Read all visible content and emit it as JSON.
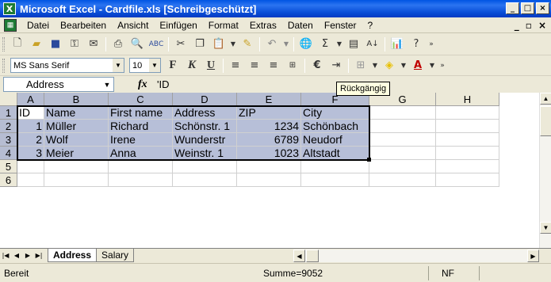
{
  "window": {
    "title": "Microsoft Excel - Cardfile.xls  [Schreibgeschützt]",
    "controls": [
      "_",
      "□",
      "×"
    ]
  },
  "menu": {
    "items": [
      "Datei",
      "Bearbeiten",
      "Ansicht",
      "Einfügen",
      "Format",
      "Extras",
      "Daten",
      "Fenster",
      "?"
    ],
    "doc_controls": [
      "_",
      "▫",
      "×"
    ]
  },
  "toolbar_standard": {
    "icons": [
      "new-icon",
      "open-icon",
      "save-icon",
      "permission-icon",
      "email-icon",
      "print-icon",
      "print-preview-icon",
      "spelling-icon",
      "cut-icon",
      "copy-icon",
      "paste-icon",
      "format-painter-icon",
      "undo-icon",
      "hyperlink-icon",
      "autosum-icon",
      "chart-wizard-icon",
      "sort-ascending-icon",
      "drawing-icon",
      "help-icon"
    ]
  },
  "toolbar_format": {
    "font_name": "MS Sans Serif",
    "font_size": "10",
    "bold": "F",
    "italic": "K",
    "underline": "U",
    "currency": "€"
  },
  "tooltip": "Rückgängig",
  "formula_bar": {
    "name_box": "Address",
    "fx": "fx",
    "content": "'ID"
  },
  "columns": [
    "A",
    "B",
    "C",
    "D",
    "E",
    "F",
    "G",
    "H"
  ],
  "rows": [
    "1",
    "2",
    "3",
    "4",
    "5",
    "6"
  ],
  "cells": [
    [
      "ID",
      "Name",
      "First name",
      "Address",
      "ZIP",
      "City"
    ],
    [
      "1",
      "Müller",
      "Richard",
      "Schönstr. 1",
      "1234",
      "Schönbach"
    ],
    [
      "2",
      "Wolf",
      "Irene",
      "Wunderstr",
      "6789",
      "Neudorf"
    ],
    [
      "3",
      "Meier",
      "Anna",
      "Weinstr. 1",
      "1023",
      "Altstadt"
    ]
  ],
  "sheets": [
    "Address",
    "Salary"
  ],
  "active_sheet": "Address",
  "status": {
    "mode": "Bereit",
    "sum": "Summe=9052",
    "numlock": "NF"
  },
  "colors": {
    "selection": "#b7bfd8",
    "title_bar": "#0054e3",
    "chrome": "#ece9d8"
  }
}
